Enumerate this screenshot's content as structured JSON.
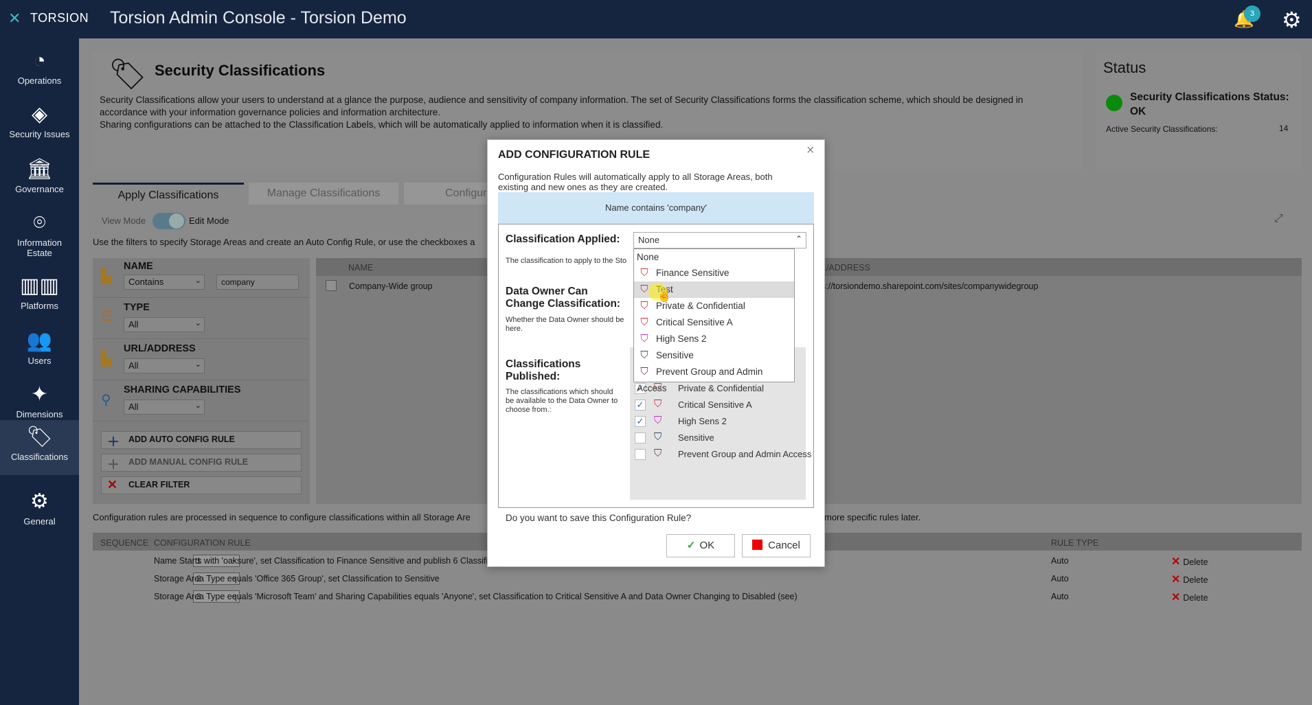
{
  "app": {
    "logo": "TORSION",
    "title": "Torsion Admin Console - Torsion Demo",
    "notification_count": "3"
  },
  "sidebar": {
    "items": [
      {
        "label": "Operations",
        "icon": "gauge-icon"
      },
      {
        "label": "Security Issues",
        "icon": "warning-diamond-icon"
      },
      {
        "label": "Governance",
        "icon": "bank-icon"
      },
      {
        "label": "Information Estate",
        "icon": "pin-icon"
      },
      {
        "label": "Platforms",
        "icon": "platforms-icon"
      },
      {
        "label": "Users",
        "icon": "users-icon"
      },
      {
        "label": "Dimensions",
        "icon": "dimensions-icon"
      },
      {
        "label": "Classifications",
        "icon": "tag-icon"
      },
      {
        "label": "General",
        "icon": "gear-icon"
      }
    ]
  },
  "header": {
    "title": "Security Classifications",
    "desc1": "Security Classifications allow your users to understand at a glance the purpose, audience and sensitivity of company information. The set of Security Classifications forms the classification scheme, which should be designed in",
    "desc2": "accordance with your information governance policies and information architecture.",
    "desc3": "Sharing configurations can be attached to the Classification Labels, which will be automatically applied to information when it is classified."
  },
  "status": {
    "title": "Status",
    "text": "Security Classifications Status: OK",
    "active_label": "Active Security Classifications:",
    "active_value": "14",
    "color": "#0a8a0a"
  },
  "tabs": [
    "Apply Classifications",
    "Manage Classifications",
    "Configur"
  ],
  "mode": {
    "view": "View Mode",
    "edit": "Edit Mode"
  },
  "filter_hint": "Use the filters to specify Storage Areas and create an Auto Config Rule, or use the checkboxes a",
  "filters": {
    "name": {
      "label": "NAME",
      "operator": "Contains",
      "value": "company"
    },
    "type": {
      "label": "TYPE",
      "value": "All"
    },
    "url": {
      "label": "URL/ADDRESS",
      "value": "All"
    },
    "sharing": {
      "label": "SHARING CAPABILITIES",
      "value": "All"
    },
    "buttons": {
      "auto": "ADD AUTO CONFIG RULE",
      "manual": "ADD MANUAL CONFIG RULE",
      "clear": "CLEAR FILTER"
    }
  },
  "results": {
    "headers": {
      "name": "NAME",
      "url": "L/ADDRESS"
    },
    "rows": [
      {
        "name": "Company-Wide group",
        "url": "s://torsiondemo.sharepoint.com/sites/companywidegroup"
      }
    ]
  },
  "sequence_note": "Configuration rules are processed in sequence to configure classifications within all Storage Are",
  "sequence_note2": "more specific rules later.",
  "rules": {
    "headers": {
      "seq": "SEQUENCE",
      "rule": "CONFIGURATION RULE",
      "type": "RULE TYPE"
    },
    "rows": [
      {
        "seq": "1",
        "text": "Name Starts with 'oaksure', set Classification to Finance Sensitive and publish 6 Classifica",
        "type": "Auto",
        "action": "Delete"
      },
      {
        "seq": "2",
        "text": "Storage Area Type equals 'Office 365 Group', set Classification to Sensitive",
        "type": "Auto",
        "action": "Delete"
      },
      {
        "seq": "3",
        "text": "Storage Area Type equals 'Microsoft Team' and Sharing Capabilities equals 'Anyone', set Classification to Critical Sensitive A and Data Owner Changing to Disabled (see)",
        "type": "Auto",
        "action": "Delete"
      }
    ]
  },
  "modal": {
    "title": "ADD CONFIGURATION RULE",
    "desc": "Configuration Rules will automatically apply to all Storage Areas, both existing and new ones as they are created.",
    "condition": "Name contains 'company'",
    "classification_label": "Classification Applied:",
    "classification_hint": "The classification to apply to the Sto",
    "classification_value": "None",
    "owner_label": "Data Owner Can Change Classification:",
    "owner_hint": "Whether the Data Owner should be here.",
    "published_label": "Classifications Published:",
    "published_hint": "The classifications which should be available to the Data Owner to choose from.:",
    "dropdown_options": [
      "None",
      "Finance Sensitive",
      "Test",
      "Private & Confidential",
      "Critical Sensitive A",
      "High Sens 2",
      "Sensitive",
      "Prevent Group and Admin Access"
    ],
    "published": [
      {
        "label": "Private & Confidential",
        "checked": true
      },
      {
        "label": "Critical Sensitive A",
        "checked": true
      },
      {
        "label": "High Sens 2",
        "checked": true
      },
      {
        "label": "Sensitive",
        "checked": false
      },
      {
        "label": "Prevent Group and Admin Access",
        "checked": false
      }
    ],
    "save_question": "Do you want to save this Configuration Rule?",
    "ok": "OK",
    "cancel": "Cancel"
  }
}
